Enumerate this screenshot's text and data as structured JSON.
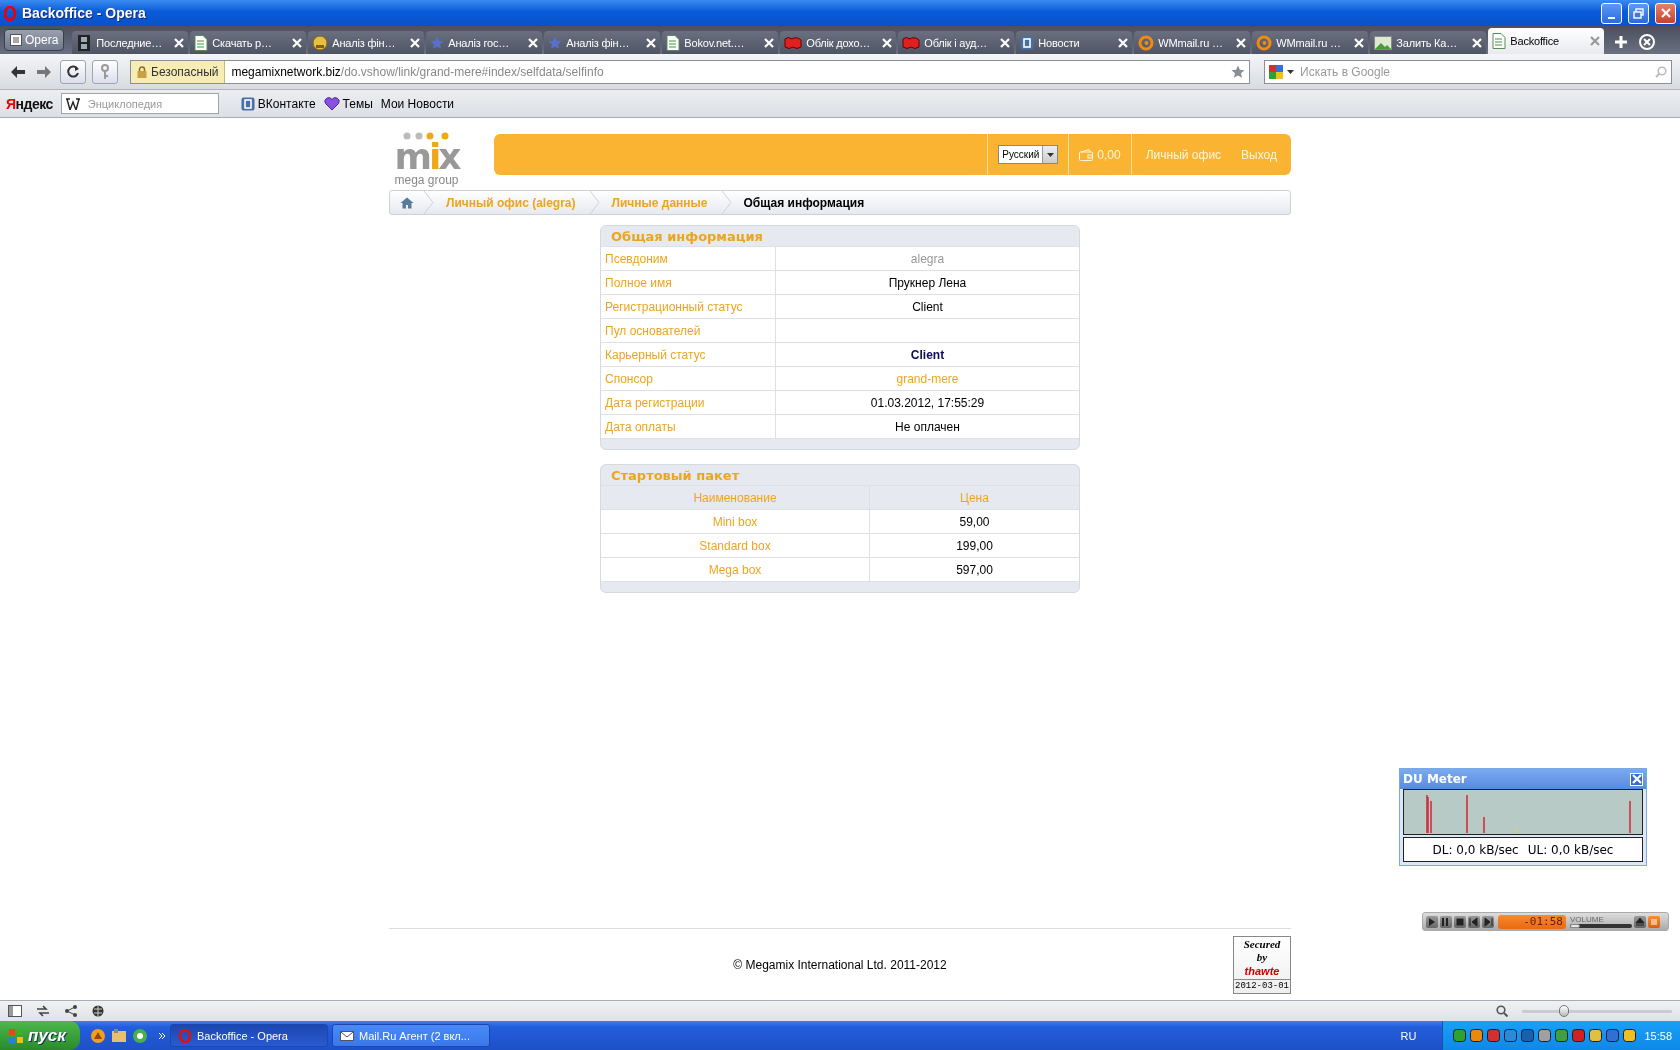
{
  "window": {
    "title": "Backoffice - Opera"
  },
  "opera_menu": "Opera",
  "tabs": [
    {
      "label": "Последние…",
      "kind": "film",
      "selected": false
    },
    {
      "label": "Скачать р…",
      "kind": "page",
      "selected": false
    },
    {
      "label": "Аналіз фін…",
      "kind": "circle",
      "selected": false
    },
    {
      "label": "Аналіз гос…",
      "kind": "star",
      "selected": false
    },
    {
      "label": "Аналіз фін…",
      "kind": "star",
      "selected": false
    },
    {
      "label": "Bokov.net.…",
      "kind": "page",
      "selected": false
    },
    {
      "label": "Облік дохо…",
      "kind": "logo",
      "selected": false
    },
    {
      "label": "Облік і ауд…",
      "kind": "logo",
      "selected": false
    },
    {
      "label": "Новости",
      "kind": "square",
      "selected": false
    },
    {
      "label": "WMmail.ru …",
      "kind": "ring",
      "selected": false
    },
    {
      "label": "WMmail.ru …",
      "kind": "ring",
      "selected": false
    },
    {
      "label": "Залить Ка…",
      "kind": "image",
      "selected": false
    },
    {
      "label": "Backoffice",
      "kind": "page",
      "selected": true
    }
  ],
  "address": {
    "security": "Безопасный",
    "host": "megamixnetwork.biz",
    "path": "/do.vshow/link/grand-mere#index/selfdata/selfinfo"
  },
  "search": {
    "placeholder": "Искать в Google"
  },
  "bookmarks": {
    "yandex": "Яндекс",
    "encyclopedia_placeholder": "Энциклопедия",
    "items": [
      {
        "label": "ВКонтакте",
        "kind": "square"
      },
      {
        "label": "Темы",
        "kind": "heart"
      },
      {
        "label": "Мои Новости",
        "kind": "text"
      }
    ]
  },
  "site": {
    "logo": {
      "word": "mix",
      "tagline": "mega group"
    },
    "language": "Русский",
    "balance": "0,00",
    "nav": [
      "Личный офис",
      "Выход"
    ],
    "breadcrumb": [
      {
        "label": "Личный офис (alegra)",
        "current": false
      },
      {
        "label": "Личные данные",
        "current": false
      },
      {
        "label": "Общая информация",
        "current": true
      }
    ],
    "info": {
      "title": "Общая информация",
      "rows": [
        {
          "label": "Псевдоним",
          "value": "alegra",
          "kind": "muted"
        },
        {
          "label": "Полное имя",
          "value": "Прукнер Лена",
          "kind": "plain"
        },
        {
          "label": "Регистрационный статус",
          "value": "Client",
          "kind": "plain"
        },
        {
          "label": "Пул основателей"
        },
        {
          "label": "Карьерный статус",
          "value": "Client",
          "kind": "strong"
        },
        {
          "label": "Спонсор",
          "value": "grand-mere",
          "kind": "link"
        },
        {
          "label": "Дата регистрации",
          "value": "01.03.2012, 17:55:29",
          "kind": "plain"
        },
        {
          "label": "Дата оплаты",
          "value": "Не оплачен",
          "kind": "plain"
        }
      ]
    },
    "package": {
      "title": "Стартовый пакет",
      "columns": [
        "Наименование",
        "Цена"
      ],
      "rows": [
        [
          "Mini box",
          "59,00"
        ],
        [
          "Standard box",
          "199,00"
        ],
        [
          "Mega box",
          "597,00"
        ]
      ]
    },
    "footer": {
      "copyright": "© Megamix International Ltd. 2011-2012",
      "seal": {
        "line1": "Secured",
        "line2": "by",
        "brand": "thawte",
        "date": "2012-03-01"
      }
    }
  },
  "du_meter": {
    "title": "DU Meter",
    "download": "DL: 0,0 kB/sec",
    "upload": "UL: 0,0 kB/sec"
  },
  "player": {
    "time": "-01:58",
    "volume": {
      "label": "VOLUME",
      "level": 0.1
    }
  },
  "status_bar": {
    "zoom": {
      "level": 0.28
    }
  },
  "taskbar": {
    "start": "пуск",
    "windows": [
      {
        "label": "Backoffice - Opera",
        "selected": true
      },
      {
        "label": "Mail.Ru Агент (2 вкл...",
        "selected": false
      }
    ],
    "language": "RU",
    "clock": "15:58"
  }
}
